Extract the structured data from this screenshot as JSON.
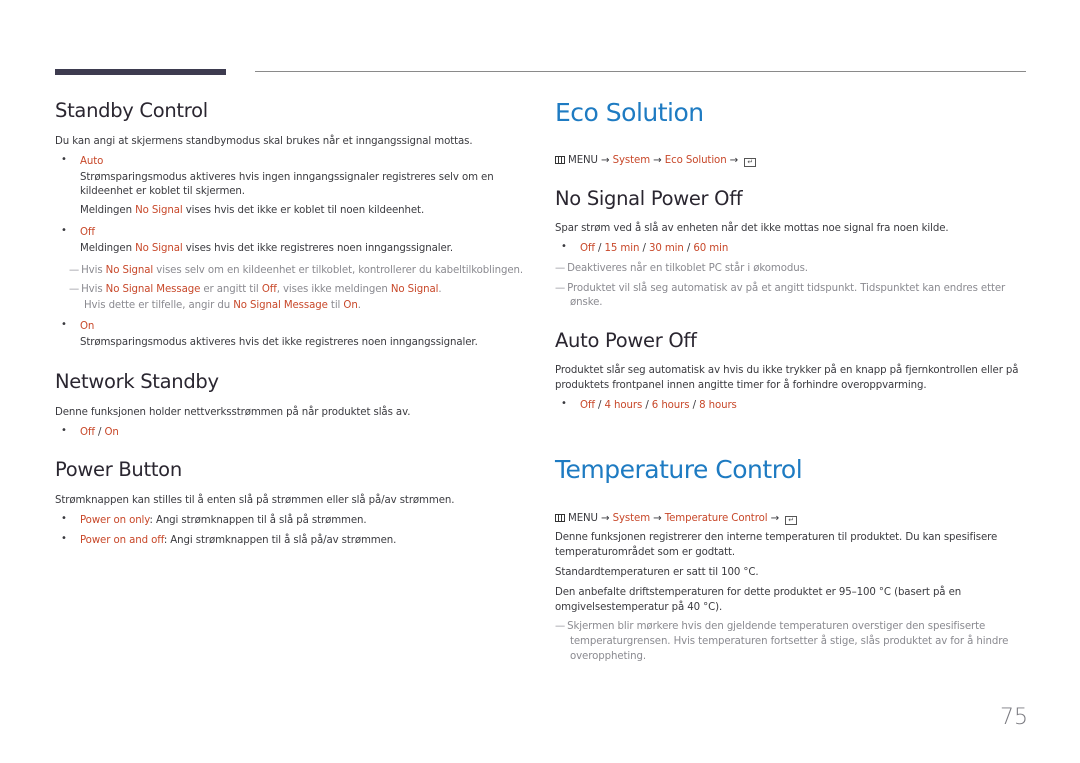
{
  "page_number": "75",
  "colors": {
    "accent_heading": "#1e7bc2",
    "highlight": "#c8482a",
    "note": "#8a8a90"
  },
  "left": {
    "standby_control": {
      "title": "Standby Control",
      "intro": "Du kan angi at skjermens standbymodus skal brukes når et inngangssignal mottas.",
      "auto": {
        "label": "Auto",
        "desc1": "Strømsparingsmodus aktiveres hvis ingen inngangssignaler registreres selv om en",
        "desc2": "kildeenhet er koblet til skjermen.",
        "msg_pre": "Meldingen ",
        "msg_hl": "No Signal",
        "msg_post": " vises hvis det ikke er koblet til noen kildeenhet."
      },
      "off": {
        "label": "Off",
        "msg_pre": "Meldingen ",
        "msg_hl": "No Signal",
        "msg_post": " vises hvis det ikke registreres noen inngangssignaler.",
        "note1_pre": "Hvis ",
        "note1_hl": "No Signal",
        "note1_post": " vises selv om en kildeenhet er tilkoblet, kontrollerer du kabeltilkoblingen.",
        "note2_a": "Hvis ",
        "note2_b": "No Signal Message",
        "note2_c": " er angitt til ",
        "note2_d": "Off",
        "note2_e": ", vises ikke meldingen ",
        "note2_f": "No Signal",
        "note2_g": ".",
        "note3_a": "Hvis dette er tilfelle, angir du ",
        "note3_b": "No Signal Message",
        "note3_c": " til ",
        "note3_d": "On",
        "note3_e": "."
      },
      "on": {
        "label": "On",
        "desc": "Strømsparingsmodus aktiveres hvis det ikke registreres noen inngangssignaler."
      }
    },
    "network_standby": {
      "title": "Network Standby",
      "intro": "Denne funksjonen holder nettverksstrømmen på når produktet slås av.",
      "opt_off": "Off",
      "sep": " / ",
      "opt_on": "On"
    },
    "power_button": {
      "title": "Power Button",
      "intro": "Strømknappen kan stilles til å enten slå på strømmen eller slå på/av strømmen.",
      "items": [
        {
          "label": "Power on only",
          "desc": ": Angi strømknappen til å slå på strømmen."
        },
        {
          "label": "Power on and off",
          "desc": ": Angi strømknappen til å slå på/av strømmen."
        }
      ]
    }
  },
  "right": {
    "eco_solution": {
      "title": "Eco Solution",
      "menu_path": {
        "menu": "MENU",
        "arrow": " → ",
        "system": "System",
        "item": "Eco Solution",
        "enter_glyph": "↵"
      },
      "no_signal_power_off": {
        "title": "No Signal Power Off",
        "intro": "Spar strøm ved å slå av enheten når det ikke mottas noe signal fra noen kilde.",
        "options": [
          "Off",
          "15 min",
          "30 min",
          "60 min"
        ],
        "sep": " / ",
        "note1": "Deaktiveres når en tilkoblet PC står i økomodus.",
        "note2a": "Produktet vil slå seg automatisk av på et angitt tidspunkt. Tidspunktet kan endres etter",
        "note2b": "ønske."
      },
      "auto_power_off": {
        "title": "Auto Power Off",
        "intro1": "Produktet slår seg automatisk av hvis du ikke trykker på en knapp på fjernkontrollen eller på",
        "intro2": "produktets frontpanel innen angitte timer for å forhindre overoppvarming.",
        "options": [
          "Off",
          "4 hours",
          "6 hours",
          "8 hours"
        ],
        "sep": " / "
      }
    },
    "temperature_control": {
      "title": "Temperature Control",
      "menu_path": {
        "menu": "MENU",
        "arrow": " → ",
        "system": "System",
        "item": "Temperature Control",
        "enter_glyph": "↵"
      },
      "p1a": "Denne funksjonen registrerer den interne temperaturen til produktet. Du kan spesifisere",
      "p1b": "temperaturområdet som er godtatt.",
      "p2": "Standardtemperaturen er satt til 100 °C.",
      "p3a": "Den anbefalte driftstemperaturen for dette produktet er 95–100 °C (basert på en",
      "p3b": "omgivelsestemperatur på 40 °C).",
      "note_a": "Skjermen blir mørkere hvis den gjeldende temperaturen overstiger den spesifiserte",
      "note_b": "temperaturgrensen. Hvis temperaturen fortsetter å stige, slås produktet av for å hindre",
      "note_c": "overoppheting."
    }
  }
}
